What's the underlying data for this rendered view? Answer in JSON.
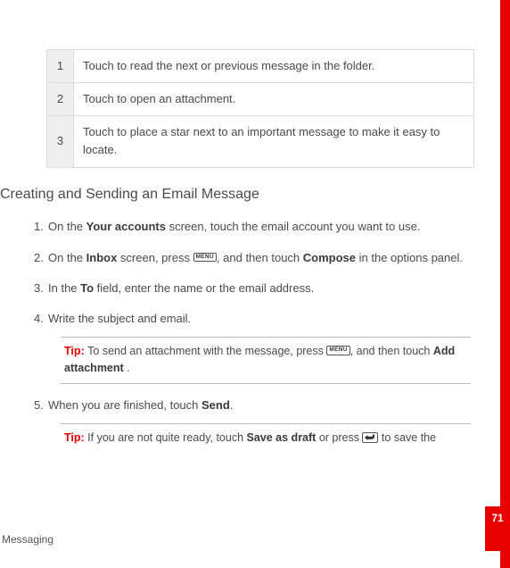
{
  "table": {
    "rows": [
      {
        "num": "1",
        "text": "Touch to read the next or previous message in the folder."
      },
      {
        "num": "2",
        "text": "Touch to open an attachment."
      },
      {
        "num": "3",
        "text": "Touch to place a star next to an important message to make it easy to locate."
      }
    ]
  },
  "section_title": "Creating and Sending an Email Message",
  "steps": {
    "s1a": "On the ",
    "s1b": "Your accounts",
    "s1c": " screen, touch the email account you want to use.",
    "s2a": "On the ",
    "s2b": "Inbox",
    "s2c": " screen, press ",
    "s2d": ", and then touch ",
    "s2e": "Compose",
    "s2f": " in the options panel.",
    "s3a": "In the ",
    "s3b": "To",
    "s3c": " field, enter the name or the email address.",
    "s4": "Write the subject and email.",
    "s5a": "When you are finished, touch ",
    "s5b": "Send",
    "s5c": "."
  },
  "tip1": {
    "label": "Tip:  ",
    "a": "To send an attachment with the message,  press ",
    "b": ", and then touch ",
    "c": "Add attachment",
    "d": " ."
  },
  "tip2": {
    "label": "Tip:  ",
    "a": "If you are not quite ready, touch ",
    "b": "Save as draft",
    "c": " or press ",
    "d": " to save the"
  },
  "menu_label": "MENU",
  "footer": "Messaging",
  "page_number": "71"
}
